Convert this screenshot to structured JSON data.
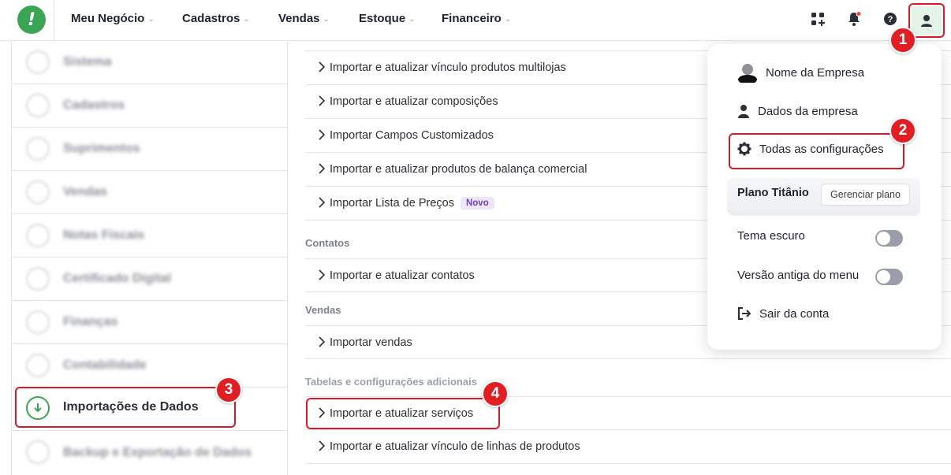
{
  "topbar": {
    "logo_text": "!",
    "nav": [
      "Meu Negócio",
      "Cadastros",
      "Vendas",
      "Estoque",
      "Financeiro"
    ],
    "notification_color": "#e8453c"
  },
  "sidebar": {
    "items": [
      "Sistema",
      "Cadastros",
      "Suprimentos",
      "Vendas",
      "Notas Fiscais",
      "Certificado Digital",
      "Finanças",
      "Contabilidade",
      "Importações de Dados",
      "Backup e Exportação de Dados"
    ],
    "active_index": 8
  },
  "main": {
    "rows_top": [
      "Importar e atualizar vínculo produtos multilojas",
      "Importar e atualizar composições",
      "Importar Campos Customizados",
      "Importar e atualizar produtos de balança comercial",
      "Importar Lista de Preços"
    ],
    "new_badge": "Novo",
    "sections": [
      {
        "title": "Contatos",
        "rows": [
          "Importar e atualizar contatos"
        ]
      },
      {
        "title": "Vendas",
        "rows": [
          "Importar vendas"
        ]
      },
      {
        "title": "Tabelas e configurações adicionais",
        "rows": [
          "Importar e atualizar serviços",
          "Importar e atualizar vínculo de linhas de produtos"
        ]
      }
    ]
  },
  "dropdown": {
    "company_name": "Nome da Empresa",
    "company_data": "Dados da empresa",
    "all_settings": "Todas as configurações",
    "plan_name": "Plano Titânio",
    "manage_plan": "Gerenciar plano",
    "dark_theme": "Tema escuro",
    "dark_theme_on": false,
    "old_menu": "Versão antiga do menu",
    "old_menu_on": false,
    "logout": "Sair da conta"
  },
  "annotations": [
    "1",
    "2",
    "3",
    "4"
  ],
  "colors": {
    "brand_green": "#3aa655",
    "highlight_red": "#d9192a",
    "badge_red": "#e01e24",
    "new_badge_bg": "#efe6fb",
    "new_badge_text": "#6c3fc4"
  }
}
